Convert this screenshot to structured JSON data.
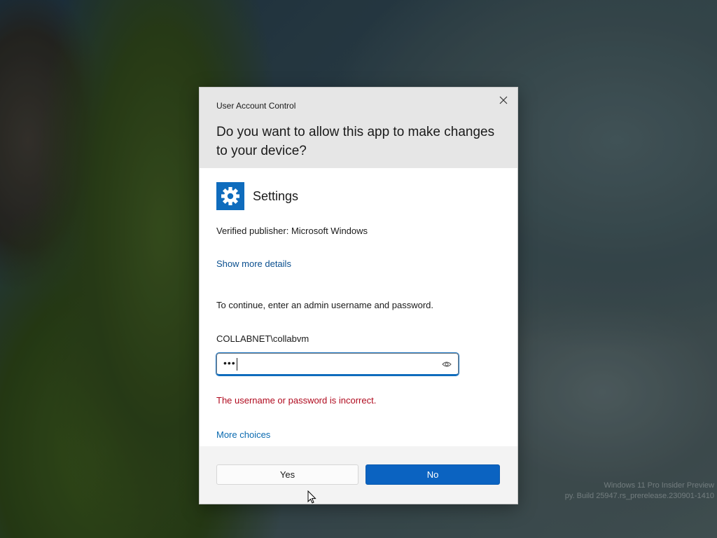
{
  "dialog": {
    "window_title": "User Account Control",
    "question": "Do you want to allow this app to make changes to your device?",
    "app_name": "Settings",
    "publisher": "Verified publisher: Microsoft Windows",
    "details_link": "Show more details",
    "instruction": "To continue, enter an admin username and password.",
    "username": "COLLABNET\\collabvm",
    "password_mask": "•••",
    "error": "The username or password is incorrect.",
    "more_choices": "More choices",
    "buttons": {
      "yes": "Yes",
      "no": "No"
    }
  },
  "desktop": {
    "watermark_line1": "Windows 11 Pro Insider Preview",
    "watermark_line2": "py. Build 25947.rs_prerelease.230901-1410"
  },
  "icons": {
    "close": "close-icon",
    "app": "settings-gear-icon",
    "reveal": "eye-icon",
    "cursor": "mouse-pointer-icon"
  },
  "colors": {
    "accent": "#0f6cbd",
    "link": "#0a4f8f",
    "error": "#b00a1e",
    "header_bg": "#e6e6e6"
  }
}
